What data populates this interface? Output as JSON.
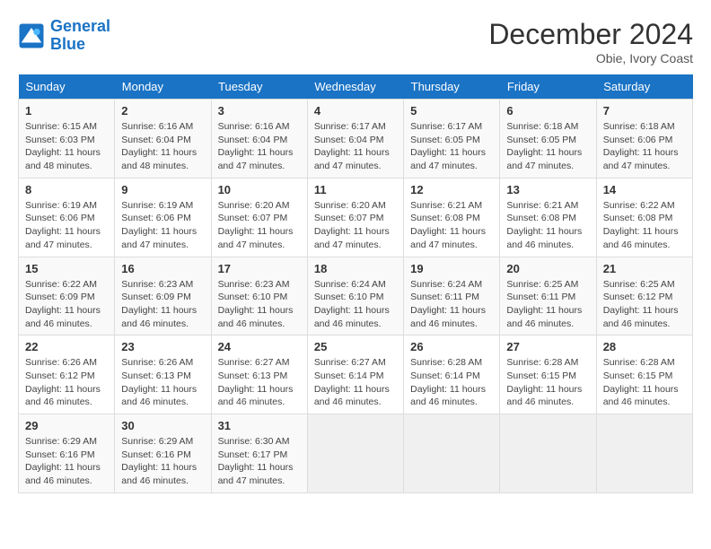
{
  "header": {
    "logo_line1": "General",
    "logo_line2": "Blue",
    "month_title": "December 2024",
    "location": "Obie, Ivory Coast"
  },
  "weekdays": [
    "Sunday",
    "Monday",
    "Tuesday",
    "Wednesday",
    "Thursday",
    "Friday",
    "Saturday"
  ],
  "weeks": [
    [
      {
        "day": 1,
        "sunrise": "6:15 AM",
        "sunset": "6:03 PM",
        "daylight": "11 hours and 48 minutes."
      },
      {
        "day": 2,
        "sunrise": "6:16 AM",
        "sunset": "6:04 PM",
        "daylight": "11 hours and 48 minutes."
      },
      {
        "day": 3,
        "sunrise": "6:16 AM",
        "sunset": "6:04 PM",
        "daylight": "11 hours and 47 minutes."
      },
      {
        "day": 4,
        "sunrise": "6:17 AM",
        "sunset": "6:04 PM",
        "daylight": "11 hours and 47 minutes."
      },
      {
        "day": 5,
        "sunrise": "6:17 AM",
        "sunset": "6:05 PM",
        "daylight": "11 hours and 47 minutes."
      },
      {
        "day": 6,
        "sunrise": "6:18 AM",
        "sunset": "6:05 PM",
        "daylight": "11 hours and 47 minutes."
      },
      {
        "day": 7,
        "sunrise": "6:18 AM",
        "sunset": "6:06 PM",
        "daylight": "11 hours and 47 minutes."
      }
    ],
    [
      {
        "day": 8,
        "sunrise": "6:19 AM",
        "sunset": "6:06 PM",
        "daylight": "11 hours and 47 minutes."
      },
      {
        "day": 9,
        "sunrise": "6:19 AM",
        "sunset": "6:06 PM",
        "daylight": "11 hours and 47 minutes."
      },
      {
        "day": 10,
        "sunrise": "6:20 AM",
        "sunset": "6:07 PM",
        "daylight": "11 hours and 47 minutes."
      },
      {
        "day": 11,
        "sunrise": "6:20 AM",
        "sunset": "6:07 PM",
        "daylight": "11 hours and 47 minutes."
      },
      {
        "day": 12,
        "sunrise": "6:21 AM",
        "sunset": "6:08 PM",
        "daylight": "11 hours and 47 minutes."
      },
      {
        "day": 13,
        "sunrise": "6:21 AM",
        "sunset": "6:08 PM",
        "daylight": "11 hours and 46 minutes."
      },
      {
        "day": 14,
        "sunrise": "6:22 AM",
        "sunset": "6:08 PM",
        "daylight": "11 hours and 46 minutes."
      }
    ],
    [
      {
        "day": 15,
        "sunrise": "6:22 AM",
        "sunset": "6:09 PM",
        "daylight": "11 hours and 46 minutes."
      },
      {
        "day": 16,
        "sunrise": "6:23 AM",
        "sunset": "6:09 PM",
        "daylight": "11 hours and 46 minutes."
      },
      {
        "day": 17,
        "sunrise": "6:23 AM",
        "sunset": "6:10 PM",
        "daylight": "11 hours and 46 minutes."
      },
      {
        "day": 18,
        "sunrise": "6:24 AM",
        "sunset": "6:10 PM",
        "daylight": "11 hours and 46 minutes."
      },
      {
        "day": 19,
        "sunrise": "6:24 AM",
        "sunset": "6:11 PM",
        "daylight": "11 hours and 46 minutes."
      },
      {
        "day": 20,
        "sunrise": "6:25 AM",
        "sunset": "6:11 PM",
        "daylight": "11 hours and 46 minutes."
      },
      {
        "day": 21,
        "sunrise": "6:25 AM",
        "sunset": "6:12 PM",
        "daylight": "11 hours and 46 minutes."
      }
    ],
    [
      {
        "day": 22,
        "sunrise": "6:26 AM",
        "sunset": "6:12 PM",
        "daylight": "11 hours and 46 minutes."
      },
      {
        "day": 23,
        "sunrise": "6:26 AM",
        "sunset": "6:13 PM",
        "daylight": "11 hours and 46 minutes."
      },
      {
        "day": 24,
        "sunrise": "6:27 AM",
        "sunset": "6:13 PM",
        "daylight": "11 hours and 46 minutes."
      },
      {
        "day": 25,
        "sunrise": "6:27 AM",
        "sunset": "6:14 PM",
        "daylight": "11 hours and 46 minutes."
      },
      {
        "day": 26,
        "sunrise": "6:28 AM",
        "sunset": "6:14 PM",
        "daylight": "11 hours and 46 minutes."
      },
      {
        "day": 27,
        "sunrise": "6:28 AM",
        "sunset": "6:15 PM",
        "daylight": "11 hours and 46 minutes."
      },
      {
        "day": 28,
        "sunrise": "6:28 AM",
        "sunset": "6:15 PM",
        "daylight": "11 hours and 46 minutes."
      }
    ],
    [
      {
        "day": 29,
        "sunrise": "6:29 AM",
        "sunset": "6:16 PM",
        "daylight": "11 hours and 46 minutes."
      },
      {
        "day": 30,
        "sunrise": "6:29 AM",
        "sunset": "6:16 PM",
        "daylight": "11 hours and 46 minutes."
      },
      {
        "day": 31,
        "sunrise": "6:30 AM",
        "sunset": "6:17 PM",
        "daylight": "11 hours and 47 minutes."
      },
      null,
      null,
      null,
      null
    ]
  ]
}
